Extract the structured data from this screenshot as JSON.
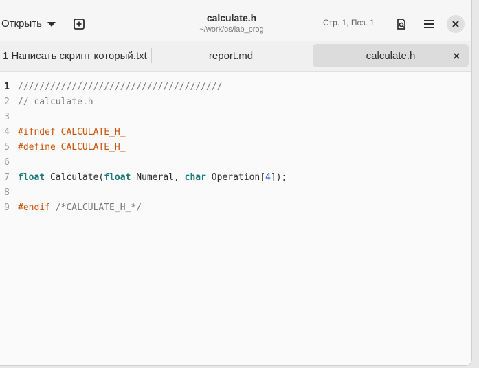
{
  "header": {
    "open_label": "Открыть",
    "title": "calculate.h",
    "subtitle": "~/work/os/lab_prog",
    "position": "Стр. 1,  Поз.  1"
  },
  "icons": {
    "open_caret": "chevron-down-icon",
    "new_tab": "plus-square-icon",
    "search": "find-in-document-icon",
    "menu": "hamburger-menu-icon",
    "close": "close-icon"
  },
  "tabs": [
    {
      "label": "1 Написать скрипт который.txt",
      "active": false
    },
    {
      "label": "report.md",
      "active": false
    },
    {
      "label": "calculate.h",
      "active": true
    }
  ],
  "editor": {
    "lines": [
      {
        "num": "1",
        "parts": [
          {
            "t": "//////////////////////////////////////",
            "k": "comment"
          }
        ]
      },
      {
        "num": "2",
        "parts": [
          {
            "t": "// calculate.h",
            "k": "comment"
          }
        ]
      },
      {
        "num": "3",
        "parts": []
      },
      {
        "num": "4",
        "parts": [
          {
            "t": "#ifndef CALCULATE_H_",
            "k": "pre"
          }
        ]
      },
      {
        "num": "5",
        "parts": [
          {
            "t": "#define CALCULATE_H_",
            "k": "pre"
          }
        ]
      },
      {
        "num": "6",
        "parts": []
      },
      {
        "num": "7",
        "parts": [
          {
            "t": "float",
            "k": "type"
          },
          {
            "t": " Calculate(",
            "k": "text"
          },
          {
            "t": "float",
            "k": "type"
          },
          {
            "t": " Numeral, ",
            "k": "text"
          },
          {
            "t": "char",
            "k": "type"
          },
          {
            "t": " Operation[",
            "k": "text"
          },
          {
            "t": "4",
            "k": "num"
          },
          {
            "t": "]);",
            "k": "text"
          }
        ]
      },
      {
        "num": "8",
        "parts": []
      },
      {
        "num": "9",
        "parts": [
          {
            "t": "#endif",
            "k": "pre"
          },
          {
            "t": " /*CALCULATE_H_*/",
            "k": "comment"
          }
        ]
      }
    ]
  }
}
